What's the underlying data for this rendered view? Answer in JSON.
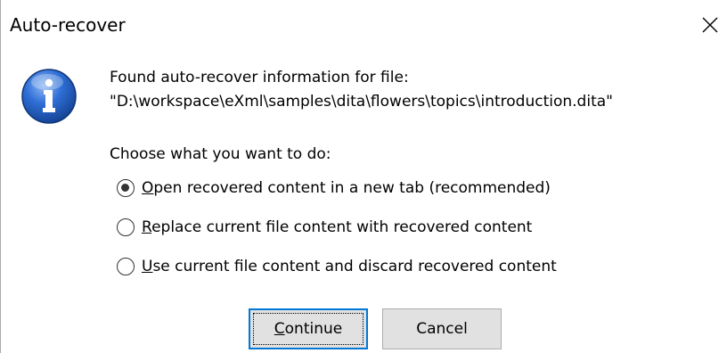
{
  "window": {
    "title": "Auto-recover",
    "close_icon": "close-icon"
  },
  "message": {
    "icon": "info-icon",
    "line1": "Found auto-recover information for file:",
    "line2": "\"D:\\workspace\\eXml\\samples\\dita\\flowers\\topics\\introduction.dita\""
  },
  "question": "Choose what you want to do:",
  "options": [
    {
      "mnemonic": "O",
      "rest": "pen recovered content in a new tab (recommended)",
      "selected": true
    },
    {
      "mnemonic": "R",
      "rest": "eplace current file content with recovered content",
      "selected": false
    },
    {
      "mnemonic": "U",
      "rest": "se current file content and discard recovered content",
      "selected": false
    }
  ],
  "buttons": {
    "continue_mnemonic": "C",
    "continue_rest": "ontinue",
    "cancel_label": "Cancel"
  },
  "colors": {
    "focus_border": "#0078d7",
    "button_face": "#e1e1e1",
    "icon_blue": "#1f5fc4"
  }
}
